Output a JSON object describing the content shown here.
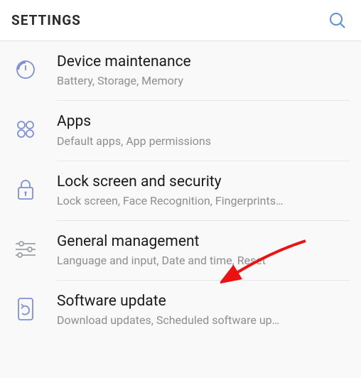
{
  "header": {
    "title": "SETTINGS"
  },
  "items": [
    {
      "title": "Device maintenance",
      "sub": "Battery, Storage, Memory"
    },
    {
      "title": "Apps",
      "sub": "Default apps, App permissions"
    },
    {
      "title": "Lock screen and security",
      "sub": "Lock screen, Face Recognition, Fingerprints…"
    },
    {
      "title": "General management",
      "sub": "Language and input, Date and time, Reset"
    },
    {
      "title": "Software update",
      "sub": "Download updates, Scheduled software up…"
    }
  ]
}
